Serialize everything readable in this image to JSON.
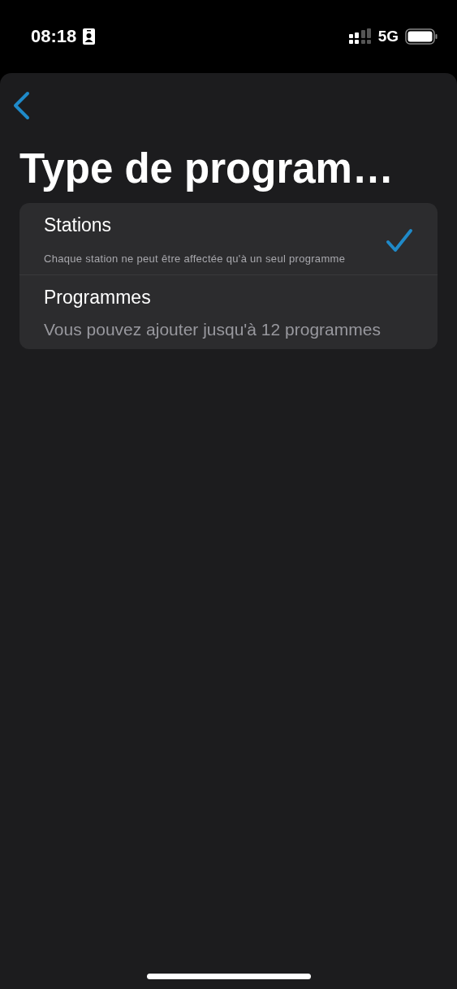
{
  "status_bar": {
    "time": "08:18",
    "network": "5G"
  },
  "title": "Type de program…",
  "options": [
    {
      "label": "Stations",
      "description": "Chaque station ne peut être affectée qu'à un seul programme",
      "selected": true,
      "kind": "small"
    },
    {
      "label": "Programmes",
      "description": "Vous pouvez ajouter jusqu'à 12 programmes",
      "selected": false,
      "kind": "large"
    }
  ]
}
